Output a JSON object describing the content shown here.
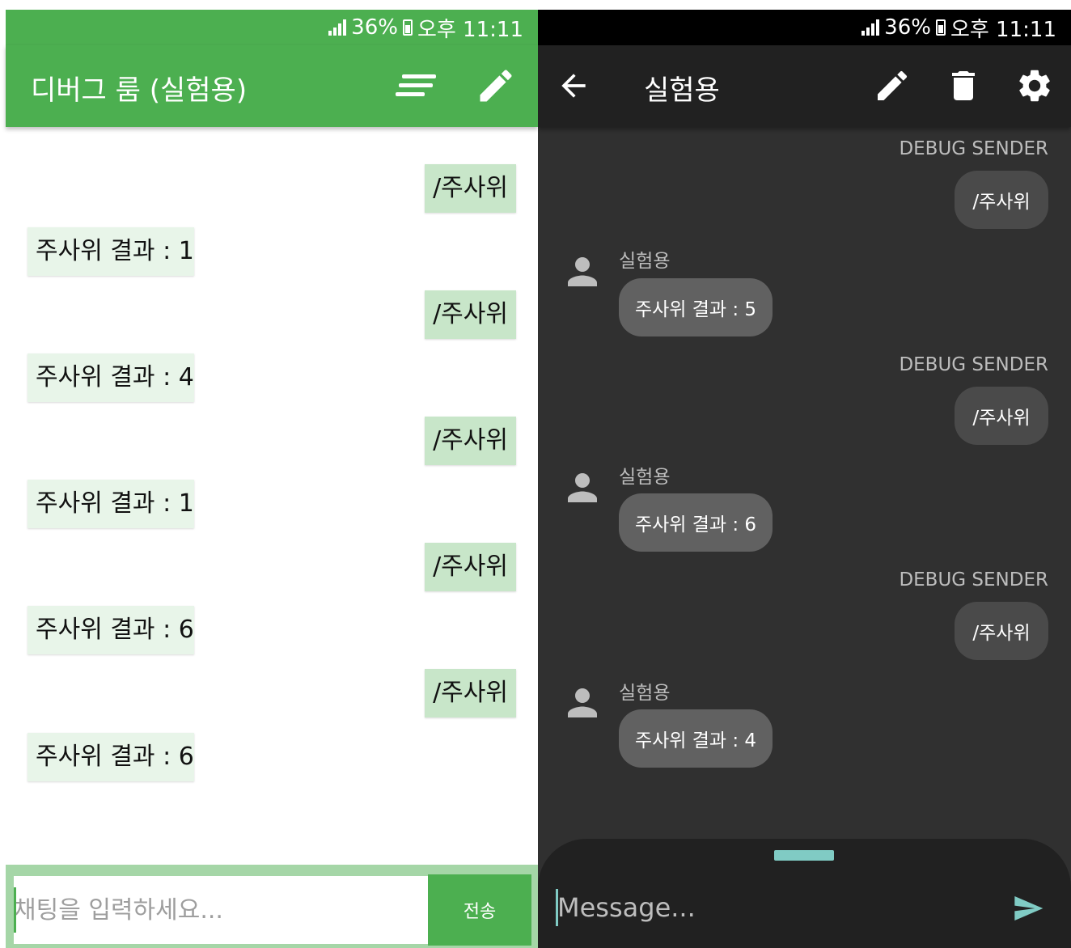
{
  "status": {
    "battery": "36%",
    "time": "오후 11:11"
  },
  "left": {
    "title": "디버그 룸 (실험용)",
    "icons": {
      "menu": "sort-menu-icon",
      "edit": "pencil-icon"
    },
    "messages": [
      {
        "side": "out",
        "text": "/주사위"
      },
      {
        "side": "in",
        "text": "주사위 결과 : 1"
      },
      {
        "side": "out",
        "text": "/주사위"
      },
      {
        "side": "in",
        "text": "주사위 결과 : 4"
      },
      {
        "side": "out",
        "text": "/주사위"
      },
      {
        "side": "in",
        "text": "주사위 결과 : 1"
      },
      {
        "side": "out",
        "text": "/주사위"
      },
      {
        "side": "in",
        "text": "주사위 결과 : 6"
      },
      {
        "side": "out",
        "text": "/주사위"
      },
      {
        "side": "in",
        "text": "주사위 결과 : 6"
      }
    ],
    "input_placeholder": "채팅을 입력하세요...",
    "send_label": "전송",
    "colors": {
      "primary": "#4caf50",
      "out_bubble": "#c8e6c9",
      "in_bubble": "#e8f5e9",
      "input_bar": "#a5d6a7"
    }
  },
  "right": {
    "title": "실험용",
    "icons": {
      "back": "arrow-back-icon",
      "edit": "pencil-icon",
      "delete": "trash-icon",
      "settings": "gear-icon",
      "send": "send-icon",
      "avatar": "person-icon"
    },
    "messages": [
      {
        "side": "out",
        "sender": "DEBUG SENDER",
        "text": "/주사위"
      },
      {
        "side": "in",
        "sender": "실험용",
        "text": "주사위 결과 : 5"
      },
      {
        "side": "out",
        "sender": "DEBUG SENDER",
        "text": "/주사위"
      },
      {
        "side": "in",
        "sender": "실험용",
        "text": "주사위 결과 : 6"
      },
      {
        "side": "out",
        "sender": "DEBUG SENDER",
        "text": "/주사위"
      },
      {
        "side": "in",
        "sender": "실험용",
        "text": "주사위 결과 : 4"
      }
    ],
    "input_placeholder": "Message...",
    "colors": {
      "background": "#303030",
      "appbar": "#212121",
      "accent": "#80cbc4",
      "out_bubble": "#4a4a4a",
      "in_bubble": "#616161"
    }
  }
}
